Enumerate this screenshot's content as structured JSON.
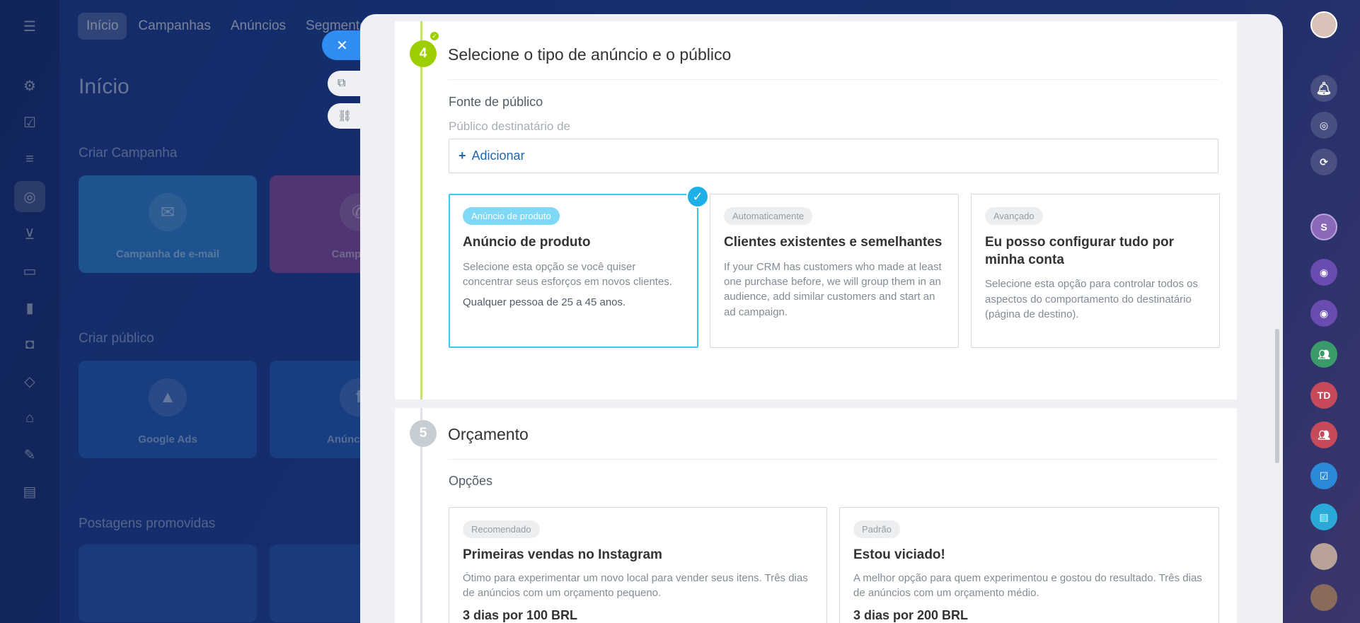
{
  "background": {
    "nav": [
      "Início",
      "Campanhas",
      "Anúncios",
      "Segmentos"
    ],
    "page_title": "Início",
    "sections": [
      "Criar Campanha",
      "Criar público",
      "Postagens promovidas"
    ],
    "cards": [
      "Campanha de e-mail",
      "Campanha",
      "Google Ads",
      "Anúncios de"
    ]
  },
  "step4": {
    "number": "4",
    "title": "Selecione o tipo de anúncio e o público",
    "source_label": "Fonte de público",
    "target_label": "Público destinatário de",
    "add_label": "Adicionar",
    "options": [
      {
        "badge": "Anúncio de produto",
        "title": "Anúncio de produto",
        "description": "Selecione esta opção se você quiser concentrar seus esforços em novos clientes.",
        "extra": "Qualquer pessoa de 25 a 45 anos."
      },
      {
        "badge": "Automaticamente",
        "title": "Clientes existentes e semelhantes",
        "description": "If your CRM has customers who made at least one purchase before, we will group them in an audience, add similar customers and start an ad campaign."
      },
      {
        "badge": "Avançado",
        "title": "Eu posso configurar tudo por minha conta",
        "description": "Selecione esta opção para controlar todos os aspectos do comportamento do destinatário (página de destino)."
      }
    ]
  },
  "step5": {
    "number": "5",
    "title": "Orçamento",
    "options_label": "Opções",
    "options": [
      {
        "badge": "Recomendado",
        "title": "Primeiras vendas no Instagram",
        "description": "Ótimo para experimentar um novo local para vender seus itens. Três dias de anúncios com um orçamento pequeno.",
        "price": "3 dias por 100 BRL"
      },
      {
        "badge": "Padrão",
        "title": "Estou viciado!",
        "description": "A melhor opção para quem experimentou e gostou do resultado. Três dias de anúncios com um orçamento médio.",
        "price": "3 dias por 200 BRL"
      }
    ]
  },
  "right_rail": {
    "avatar_initials": [
      "S",
      "TD"
    ]
  },
  "colors": {
    "accent_green": "#9dcf00",
    "selected_blue": "#3bc8f5",
    "link_blue": "#2067b0"
  }
}
